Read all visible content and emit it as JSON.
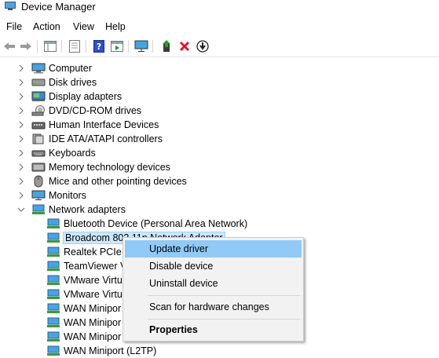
{
  "window": {
    "title": "Device Manager"
  },
  "menu": [
    "File",
    "Action",
    "View",
    "Help"
  ],
  "toolbar": {
    "buttons": [
      "back-arrow-icon",
      "forward-arrow-icon",
      "show-hide-tree-icon",
      "properties-sheet-icon",
      "help-icon",
      "action-pane-icon",
      "monitor-icon",
      "update-driver-icon",
      "uninstall-icon",
      "download-icon"
    ]
  },
  "tree": {
    "categories": [
      {
        "label": "Computer",
        "icon": "computer-icon"
      },
      {
        "label": "Disk drives",
        "icon": "disk-drive-icon"
      },
      {
        "label": "Display adapters",
        "icon": "display-adapter-icon"
      },
      {
        "label": "DVD/CD-ROM drives",
        "icon": "dvd-icon"
      },
      {
        "label": "Human Interface Devices",
        "icon": "hid-icon"
      },
      {
        "label": "IDE ATA/ATAPI controllers",
        "icon": "ide-icon"
      },
      {
        "label": "Keyboards",
        "icon": "keyboard-icon"
      },
      {
        "label": "Memory technology devices",
        "icon": "memory-icon"
      },
      {
        "label": "Mice and other pointing devices",
        "icon": "mouse-icon"
      },
      {
        "label": "Monitors",
        "icon": "monitor-icon"
      },
      {
        "label": "Network adapters",
        "icon": "network-adapter-icon"
      }
    ],
    "network_children": [
      "Bluetooth Device (Personal Area Network)",
      "Broadcom 802.11n Network Adapter",
      "Realtek PCIe G",
      "TeamViewer V",
      "VMware Virtua",
      "VMware Virtua",
      "WAN Minipor",
      "WAN Minipor",
      "WAN Minipor",
      "WAN Miniport (L2TP)"
    ]
  },
  "context_menu": {
    "update": "Update driver",
    "disable": "Disable device",
    "uninstall": "Uninstall device",
    "scan": "Scan for hardware changes",
    "properties": "Properties"
  },
  "colors": {
    "selection": "#cce8ff",
    "menu_highlight": "#91c9f7",
    "uninstall_red": "#e81123"
  }
}
